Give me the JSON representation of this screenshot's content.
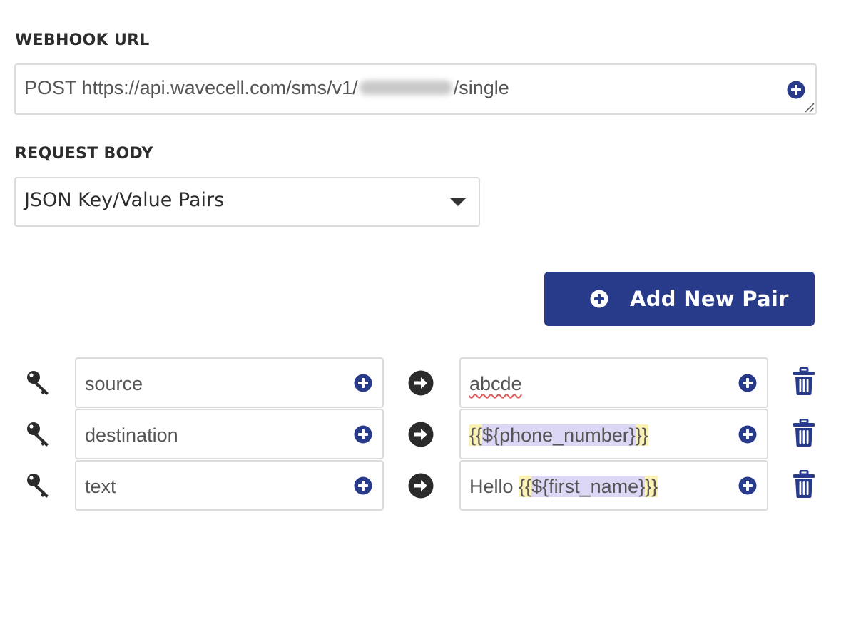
{
  "webhook": {
    "label": "WEBHOOK URL",
    "method": "POST",
    "url_prefix": "https://api.wavecell.com/sms/v1/",
    "url_suffix": "/single",
    "insert_icon": "plus-circle-icon"
  },
  "request_body": {
    "label": "REQUEST BODY",
    "selected": "JSON Key/Value Pairs"
  },
  "add_pair": {
    "label": "Add New Pair",
    "icon": "plus-circle-icon"
  },
  "pairs": [
    {
      "key": "source",
      "value": {
        "plain": "abcde"
      }
    },
    {
      "key": "destination",
      "value": {
        "prefix": "",
        "open": "{{",
        "var": "${phone_number}",
        "close": "}}"
      }
    },
    {
      "key": "text",
      "value": {
        "prefix": "Hello ",
        "open": "{{",
        "var": "${first_name}",
        "close": "}}"
      }
    }
  ],
  "colors": {
    "accent": "#283a8a",
    "border": "#dcdcdc",
    "highlight_brace": "#fbf1b5",
    "highlight_var": "#ddd7f6"
  }
}
